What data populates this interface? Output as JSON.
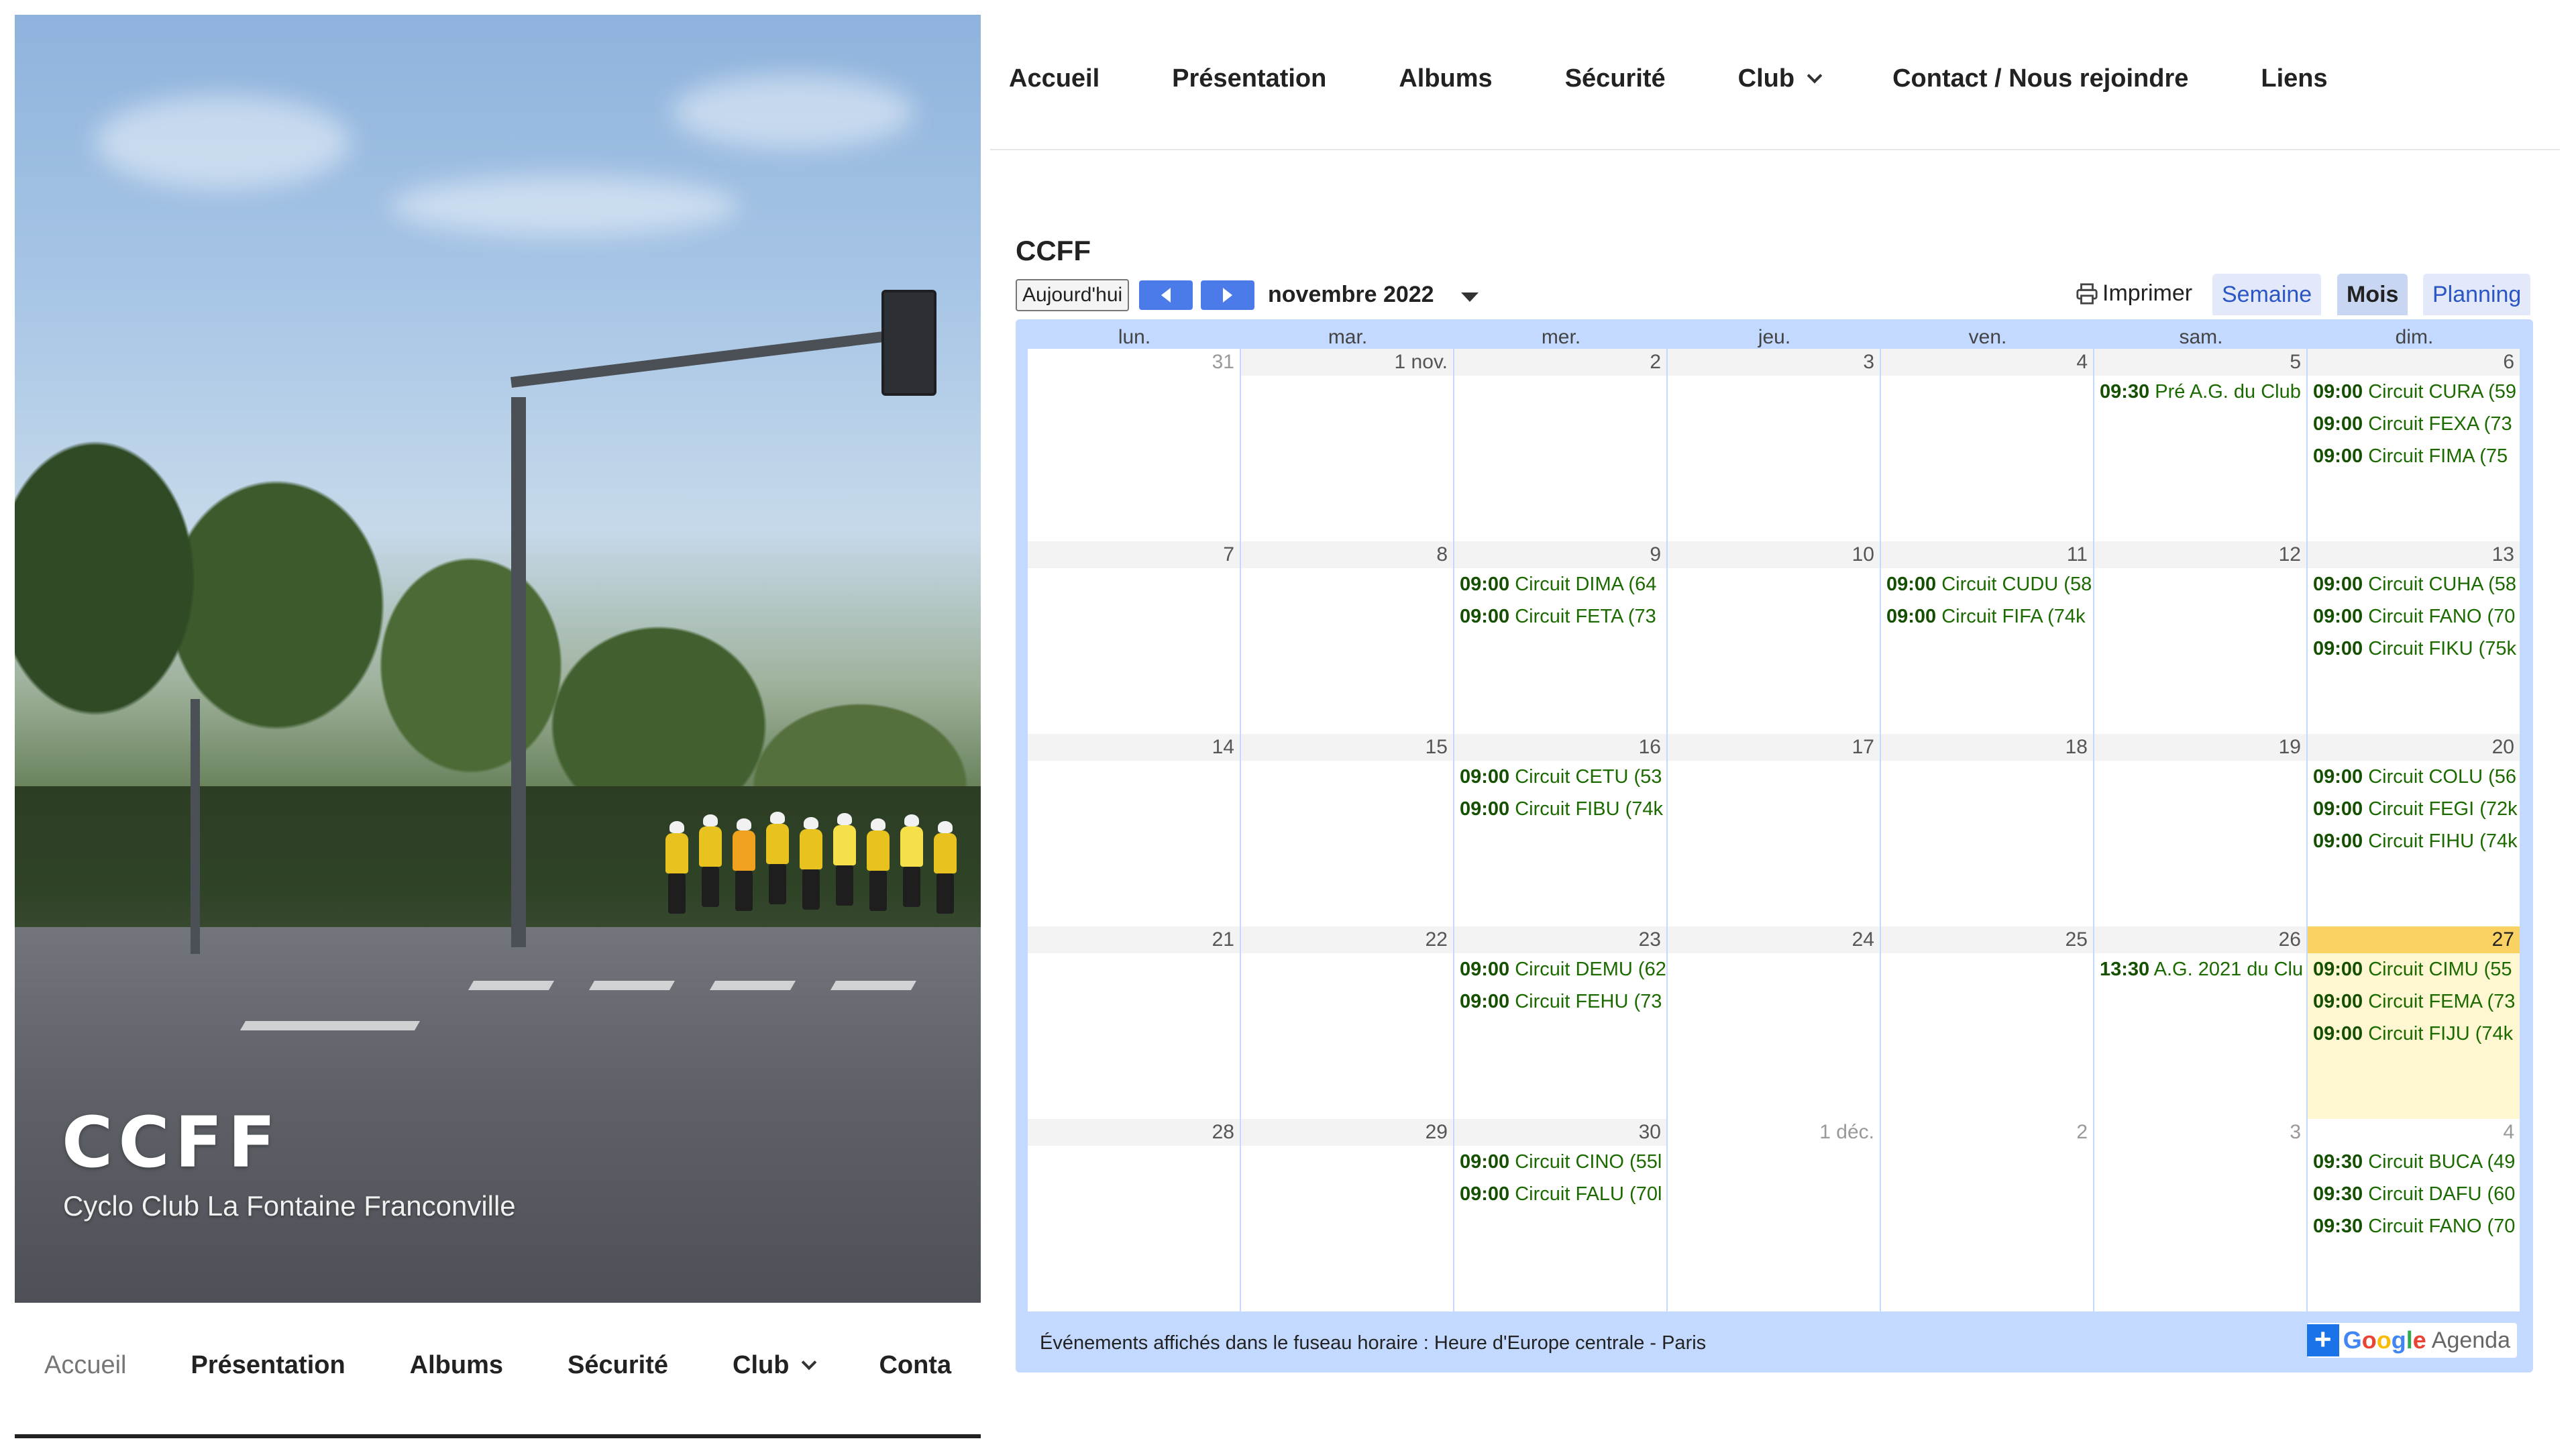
{
  "site": {
    "title": "CCFF",
    "description": "Cyclo Club La Fontaine Franconville"
  },
  "left_nav": {
    "items": [
      {
        "label": "Accueil",
        "current": true,
        "dropdown": false
      },
      {
        "label": "Présentation",
        "current": false,
        "dropdown": false
      },
      {
        "label": "Albums",
        "current": false,
        "dropdown": false
      },
      {
        "label": "Sécurité",
        "current": false,
        "dropdown": false
      },
      {
        "label": "Club",
        "current": false,
        "dropdown": true
      },
      {
        "label": "Conta",
        "current": false,
        "dropdown": false
      }
    ]
  },
  "top_nav": {
    "items": [
      {
        "label": "Accueil",
        "dropdown": false
      },
      {
        "label": "Présentation",
        "dropdown": false
      },
      {
        "label": "Albums",
        "dropdown": false
      },
      {
        "label": "Sécurité",
        "dropdown": false
      },
      {
        "label": "Club",
        "dropdown": true
      },
      {
        "label": "Contact / Nous rejoindre",
        "dropdown": false
      },
      {
        "label": "Liens",
        "dropdown": false
      }
    ]
  },
  "calendar": {
    "title": "CCFF",
    "today_label": "Aujourd'hui",
    "month_label": "novembre 2022",
    "print_label": "Imprimer",
    "views": [
      {
        "label": "Semaine",
        "active": false
      },
      {
        "label": "Mois",
        "active": true
      },
      {
        "label": "Planning",
        "active": false
      }
    ],
    "weekdays": [
      "lun.",
      "mar.",
      "mer.",
      "jeu.",
      "ven.",
      "sam.",
      "dim."
    ],
    "weeks": [
      [
        {
          "day": "31",
          "other": true,
          "events": []
        },
        {
          "day": "1 nov.",
          "events": []
        },
        {
          "day": "2",
          "events": []
        },
        {
          "day": "3",
          "events": []
        },
        {
          "day": "4",
          "events": []
        },
        {
          "day": "5",
          "events": [
            {
              "time": "09:30",
              "title": "Pré A.G. du Club"
            }
          ]
        },
        {
          "day": "6",
          "events": [
            {
              "time": "09:00",
              "title": "Circuit CURA (59"
            },
            {
              "time": "09:00",
              "title": "Circuit FEXA (73"
            },
            {
              "time": "09:00",
              "title": "Circuit FIMA (75"
            }
          ]
        }
      ],
      [
        {
          "day": "7",
          "events": []
        },
        {
          "day": "8",
          "events": []
        },
        {
          "day": "9",
          "events": [
            {
              "time": "09:00",
              "title": "Circuit DIMA (64"
            },
            {
              "time": "09:00",
              "title": "Circuit FETA (73"
            }
          ]
        },
        {
          "day": "10",
          "events": []
        },
        {
          "day": "11",
          "events": [
            {
              "time": "09:00",
              "title": "Circuit CUDU (58"
            },
            {
              "time": "09:00",
              "title": "Circuit FIFA (74k"
            }
          ]
        },
        {
          "day": "12",
          "events": []
        },
        {
          "day": "13",
          "events": [
            {
              "time": "09:00",
              "title": "Circuit CUHA (58"
            },
            {
              "time": "09:00",
              "title": "Circuit FANO (70"
            },
            {
              "time": "09:00",
              "title": "Circuit FIKU (75k"
            }
          ]
        }
      ],
      [
        {
          "day": "14",
          "events": []
        },
        {
          "day": "15",
          "events": []
        },
        {
          "day": "16",
          "events": [
            {
              "time": "09:00",
              "title": "Circuit CETU (53"
            },
            {
              "time": "09:00",
              "title": "Circuit FIBU (74k"
            }
          ]
        },
        {
          "day": "17",
          "events": []
        },
        {
          "day": "18",
          "events": []
        },
        {
          "day": "19",
          "events": []
        },
        {
          "day": "20",
          "events": [
            {
              "time": "09:00",
              "title": "Circuit COLU (56"
            },
            {
              "time": "09:00",
              "title": "Circuit FEGI (72k"
            },
            {
              "time": "09:00",
              "title": "Circuit FIHU (74k"
            }
          ]
        }
      ],
      [
        {
          "day": "21",
          "events": []
        },
        {
          "day": "22",
          "events": []
        },
        {
          "day": "23",
          "events": [
            {
              "time": "09:00",
              "title": "Circuit DEMU (62"
            },
            {
              "time": "09:00",
              "title": "Circuit FEHU (73"
            }
          ]
        },
        {
          "day": "24",
          "events": []
        },
        {
          "day": "25",
          "events": []
        },
        {
          "day": "26",
          "events": [
            {
              "time": "13:30",
              "title": "A.G. 2021 du Clu"
            }
          ]
        },
        {
          "day": "27",
          "today": true,
          "events": [
            {
              "time": "09:00",
              "title": "Circuit CIMU (55"
            },
            {
              "time": "09:00",
              "title": "Circuit FEMA (73"
            },
            {
              "time": "09:00",
              "title": "Circuit FIJU (74k"
            }
          ]
        }
      ],
      [
        {
          "day": "28",
          "events": []
        },
        {
          "day": "29",
          "events": []
        },
        {
          "day": "30",
          "events": [
            {
              "time": "09:00",
              "title": "Circuit CINO (55l"
            },
            {
              "time": "09:00",
              "title": "Circuit FALU (70l"
            }
          ]
        },
        {
          "day": "1 déc.",
          "other": true,
          "events": []
        },
        {
          "day": "2",
          "other": true,
          "events": []
        },
        {
          "day": "3",
          "other": true,
          "events": []
        },
        {
          "day": "4",
          "other": true,
          "events": [
            {
              "time": "09:30",
              "title": "Circuit BUCA (49"
            },
            {
              "time": "09:30",
              "title": "Circuit DAFU (60"
            },
            {
              "time": "09:30",
              "title": "Circuit FANO (70"
            }
          ]
        }
      ]
    ],
    "timezone_note": "Événements affichés dans le fuseau horaire : Heure d'Europe centrale - Paris",
    "google_badge": {
      "plus": "+",
      "letters": [
        {
          "char": "G",
          "color": "#4285f4"
        },
        {
          "char": "o",
          "color": "#ea4335"
        },
        {
          "char": "o",
          "color": "#fbbc05"
        },
        {
          "char": "g",
          "color": "#4285f4"
        },
        {
          "char": "l",
          "color": "#34a853"
        },
        {
          "char": "e",
          "color": "#ea4335"
        }
      ],
      "agenda": "Agenda"
    }
  },
  "colors": {
    "event_text": "#1b6a00",
    "grid_border": "#c3d9ff",
    "today_bg": "#fff7d1",
    "today_header": "#fad163",
    "nav_button": "#4a7be8"
  }
}
